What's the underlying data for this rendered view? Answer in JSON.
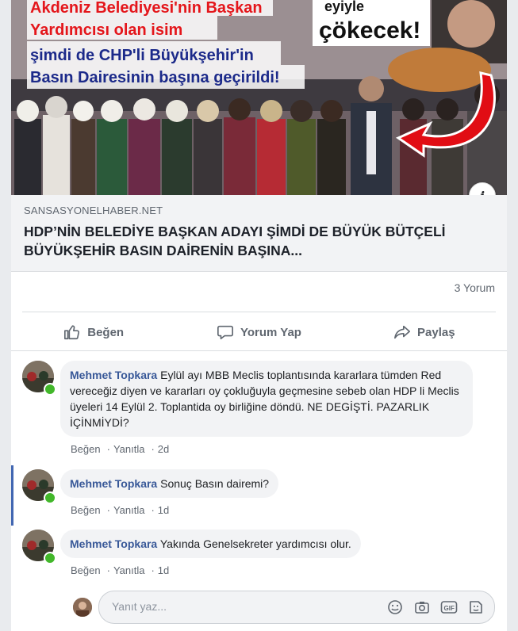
{
  "hero": {
    "headline_lines": [
      "Akdeniz Belediyesi'nin Başkan",
      "Yardımcısı olan isim",
      "şimdi de CHP'li Büyükşehir'in",
      "Basın Dairesinin başına geçirildi!"
    ],
    "badge_top": "eyiyle",
    "badge_text": "çökecek!",
    "colors": {
      "red": "#e4161b",
      "blue": "#1c2a8a",
      "arrow": "#e10d14"
    }
  },
  "link": {
    "domain": "SANSASYONELHABER.NET",
    "title": "HDP’NİN BELEDİYE BAŞKAN ADAYI ŞİMDİ DE BÜYÜK BÜTÇELİ BÜYÜKŞEHİR BASIN DAİRENİN BAŞINA..."
  },
  "counts": {
    "comments": "3 Yorum"
  },
  "actions": {
    "like": "Beğen",
    "comment": "Yorum Yap",
    "share": "Paylaş"
  },
  "comments": [
    {
      "author": "Mehmet Topkara",
      "text": "Eylül ayı MBB Meclis toplantısında kararlara tümden Red vereceğiz diyen ve kararları oy çokluğuyla geçmesine sebeb olan HDP li Meclis üyeleri 14 Eylül 2. Toplantida oy birliğine döndü. NE DEGİŞTİ. PAZARLIK İÇİNMİYDİ?",
      "like": "Beğen",
      "reply": "Yanıtla",
      "time": "2d"
    },
    {
      "author": "Mehmet Topkara",
      "text": "Sonuç Basın dairemi?",
      "like": "Beğen",
      "reply": "Yanıtla",
      "time": "1d"
    },
    {
      "author": "Mehmet Topkara",
      "text": "Yakında Genelsekreter yardımcısı olur.",
      "like": "Beğen",
      "reply": "Yanıtla",
      "time": "1d"
    }
  ],
  "reply": {
    "placeholder": "Yanıt yaz..."
  },
  "accent": {
    "link_blue": "#385898",
    "online_green": "#42b72a",
    "thread_bar": "#4267b2"
  }
}
